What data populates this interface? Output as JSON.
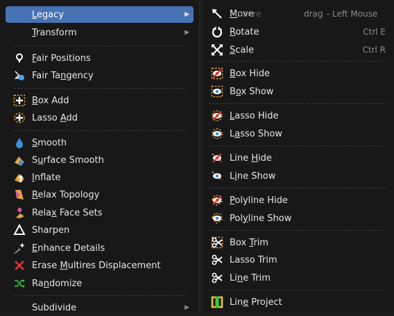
{
  "left_menu": {
    "items": [
      {
        "label": "Legacy",
        "mnemonic": "L",
        "submenu": true,
        "icon": "none"
      },
      {
        "label": "Transform",
        "mnemonic": "T",
        "submenu": true,
        "icon": "none"
      },
      {
        "label": "Fair Positions",
        "mnemonic": "F",
        "icon": "fair-positions-icon"
      },
      {
        "label": "Fair Tangency",
        "mnemonic": "n",
        "icon": "fair-tangency-icon"
      },
      {
        "label": "Box Add",
        "mnemonic": "B",
        "icon": "box-add-icon"
      },
      {
        "label": "Lasso Add",
        "mnemonic": "A",
        "icon": "lasso-add-icon"
      },
      {
        "label": "Smooth",
        "mnemonic": "S",
        "icon": "smooth-icon"
      },
      {
        "label": "Surface Smooth",
        "mnemonic": "u",
        "icon": "surface-smooth-icon"
      },
      {
        "label": "Inflate",
        "mnemonic": "I",
        "icon": "inflate-icon"
      },
      {
        "label": "Relax Topology",
        "mnemonic": "R",
        "icon": "relax-topology-icon"
      },
      {
        "label": "Relax Face Sets",
        "mnemonic": "x",
        "icon": "relax-face-sets-icon"
      },
      {
        "label": "Sharpen",
        "mnemonic": "",
        "icon": "sharpen-icon"
      },
      {
        "label": "Enhance Details",
        "mnemonic": "E",
        "icon": "enhance-details-icon"
      },
      {
        "label": "Erase Multires Displacement",
        "mnemonic": "M",
        "icon": "erase-displacement-icon"
      },
      {
        "label": "Randomize",
        "mnemonic": "n",
        "icon": "randomize-icon"
      },
      {
        "label": "Subdivide",
        "mnemonic": "",
        "submenu": true,
        "icon": "none"
      }
    ]
  },
  "right_menu": {
    "items": [
      {
        "label": "Move",
        "mnemonic": "M",
        "shortcut": "",
        "icon": "move-icon"
      },
      {
        "label": "Rotate",
        "mnemonic": "R",
        "shortcut": "Ctrl E",
        "icon": "rotate-icon"
      },
      {
        "label": "Scale",
        "mnemonic": "S",
        "shortcut": "Ctrl R",
        "icon": "scale-icon"
      },
      {
        "label": "Box Hide",
        "mnemonic": "B",
        "shortcut": "",
        "icon": "box-hide-icon"
      },
      {
        "label": "Box Show",
        "mnemonic": "o",
        "shortcut": "",
        "icon": "box-show-icon"
      },
      {
        "label": "Lasso Hide",
        "mnemonic": "L",
        "shortcut": "",
        "icon": "lasso-hide-icon"
      },
      {
        "label": "Lasso Show",
        "mnemonic": "a",
        "shortcut": "",
        "icon": "lasso-show-icon"
      },
      {
        "label": "Line Hide",
        "mnemonic": "H",
        "shortcut": "",
        "icon": "line-hide-icon"
      },
      {
        "label": "Line Show",
        "mnemonic": "i",
        "shortcut": "",
        "icon": "line-show-icon"
      },
      {
        "label": "Polyline Hide",
        "mnemonic": "P",
        "shortcut": "",
        "icon": "polyline-hide-icon"
      },
      {
        "label": "Polyline Show",
        "mnemonic": "y",
        "shortcut": "",
        "icon": "polyline-show-icon"
      },
      {
        "label": "Box Trim",
        "mnemonic": "T",
        "shortcut": "",
        "icon": "box-trim-icon"
      },
      {
        "label": "Lasso Trim",
        "mnemonic": "",
        "shortcut": "",
        "icon": "lasso-trim-icon"
      },
      {
        "label": "Line Trim",
        "mnemonic": "n",
        "shortcut": "",
        "icon": "line-trim-icon"
      },
      {
        "label": "Line Project",
        "mnemonic": "e",
        "shortcut": "",
        "icon": "line-project-icon"
      }
    ]
  },
  "background_header": {
    "texture": "exture",
    "drag": "drag",
    "separator": "-",
    "left_mouse": "Left Mouse"
  },
  "colors": {
    "menu_bg": "#181818",
    "highlight": "#4772b3",
    "text": "#e6e6e6",
    "shortcut_text": "#8e8e8e",
    "separator": "#3a3a3a"
  }
}
